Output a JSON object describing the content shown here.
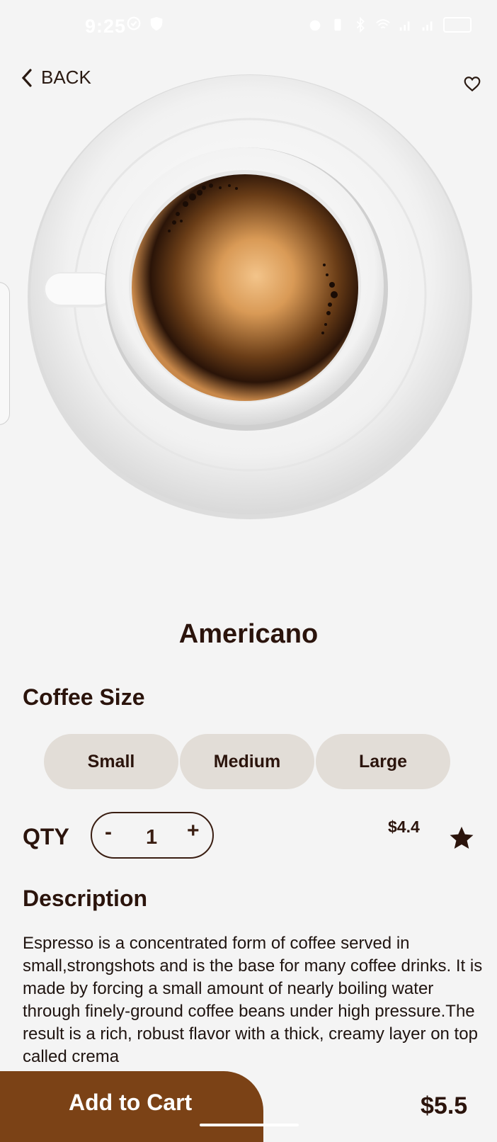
{
  "status_bar": {
    "time": "9:25"
  },
  "header": {
    "back_label": "BACK"
  },
  "product": {
    "name": "Americano",
    "unit_price": "$4.4",
    "total_price": "$5.5"
  },
  "size": {
    "heading": "Coffee Size",
    "options": [
      "Small",
      "Medium",
      "Large"
    ]
  },
  "quantity": {
    "label": "QTY",
    "minus": "-",
    "value": "1",
    "plus": "+"
  },
  "description": {
    "heading": "Description",
    "text": "Espresso is a concentrated form of coffee served in small,strongshots and is the base for many coffee drinks. It is made by forcing a small amount of nearly boiling water through finely-ground coffee beans under high pressure.The result is a rich, robust flavor with a thick, creamy layer on top called crema"
  },
  "cart": {
    "button_label": "Add to Cart"
  },
  "colors": {
    "accent": "#7b4216",
    "text_dark": "#2b140c",
    "chip_bg": "#e2ddd7",
    "background": "#f4f4f4"
  }
}
